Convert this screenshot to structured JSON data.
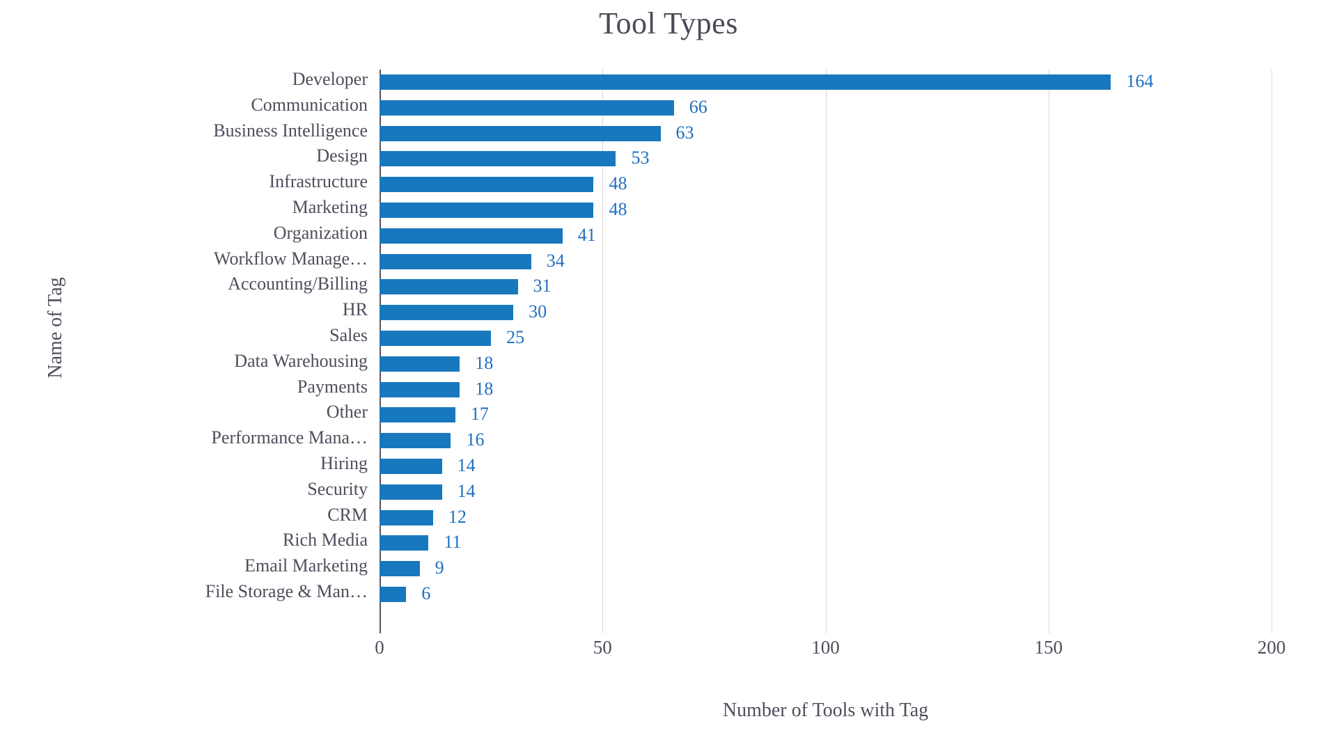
{
  "chart_data": {
    "type": "bar",
    "orientation": "horizontal",
    "title": "Tool Types",
    "xlabel": "Number of Tools with Tag",
    "ylabel": "Name of Tag",
    "xlim": [
      0,
      200
    ],
    "xticks": [
      "0",
      "50",
      "100",
      "150",
      "200"
    ],
    "xtick_values": [
      0,
      50,
      100,
      150,
      200
    ],
    "grid": true,
    "grid_axis": "x",
    "legend": false,
    "bar_color": "#1878be",
    "label_color": "#1f6fc0",
    "text_color": "#4e4e5c",
    "show_value_labels": true,
    "categories": [
      "Developer",
      "Communication",
      "Business Intelligence",
      "Design",
      "Infrastructure",
      "Marketing",
      "Organization",
      "Workflow Manage…",
      "Accounting/Billing",
      "HR",
      "Sales",
      "Data Warehousing",
      "Payments",
      "Other",
      "Performance Mana…",
      "Hiring",
      "Security",
      "CRM",
      "Rich Media",
      "Email Marketing",
      "File Storage & Man…"
    ],
    "values": [
      164,
      66,
      63,
      53,
      48,
      48,
      41,
      34,
      31,
      30,
      25,
      18,
      18,
      17,
      16,
      14,
      14,
      12,
      11,
      9,
      6
    ],
    "value_labels": [
      "164",
      "66",
      "63",
      "53",
      "48",
      "48",
      "41",
      "34",
      "31",
      "30",
      "25",
      "18",
      "18",
      "17",
      "16",
      "14",
      "14",
      "12",
      "11",
      "9",
      "6"
    ]
  }
}
